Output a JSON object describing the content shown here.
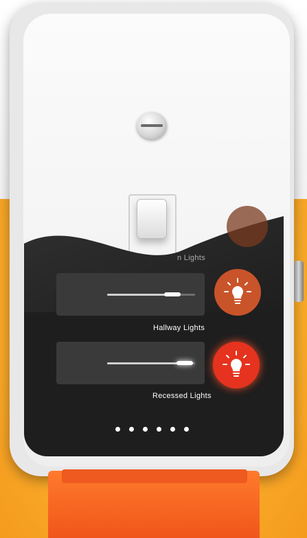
{
  "controls": [
    {
      "label": "Hallway Lights",
      "level": 0.74,
      "state": "dim",
      "icon": "lightbulb-icon",
      "icon_color": "#c9542a"
    },
    {
      "label": "Recessed Lights",
      "level": 0.88,
      "state": "on",
      "icon": "lightbulb-icon",
      "icon_color": "#e5331f"
    }
  ],
  "partial_label": "n Lights",
  "pager": {
    "count": 6
  },
  "colors": {
    "screen": "#1e1e1e",
    "accent_on": "#e5331f",
    "accent_dim": "#c9542a",
    "base": "#f36420"
  }
}
